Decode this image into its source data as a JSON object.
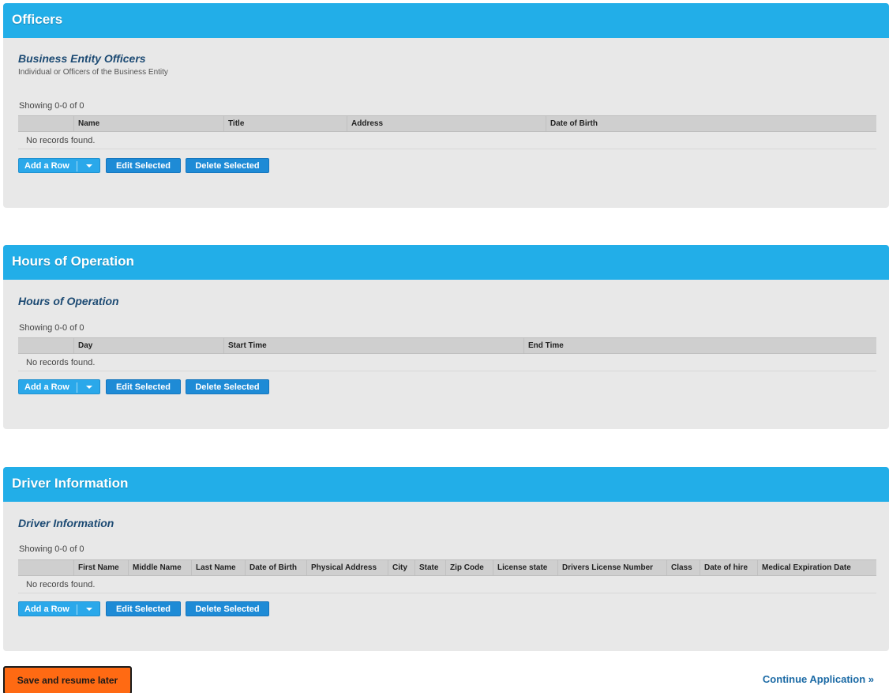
{
  "officers": {
    "header": "Officers",
    "subtitle": "Business Entity Officers",
    "description": "Individual or Officers of the Business Entity",
    "showing": "Showing 0-0 of 0",
    "columns": [
      "Name",
      "Title",
      "Address",
      "Date of Birth"
    ],
    "empty": "No records found.",
    "buttons": {
      "add": "Add a Row",
      "edit": "Edit Selected",
      "delete": "Delete Selected"
    }
  },
  "hours": {
    "header": "Hours of Operation",
    "subtitle": "Hours of Operation",
    "showing": "Showing 0-0 of 0",
    "columns": [
      "Day",
      "Start Time",
      "End Time"
    ],
    "empty": "No records found.",
    "buttons": {
      "add": "Add a Row",
      "edit": "Edit Selected",
      "delete": "Delete Selected"
    }
  },
  "drivers": {
    "header": "Driver Information",
    "subtitle": "Driver Information",
    "showing": "Showing 0-0 of 0",
    "columns": [
      "First Name",
      "Middle Name",
      "Last Name",
      "Date of Birth",
      "Physical Address",
      "City",
      "State",
      "Zip Code",
      "License state",
      "Drivers License Number",
      "Class",
      "Date of hire",
      "Medical Expiration Date"
    ],
    "empty": "No records found.",
    "buttons": {
      "add": "Add a Row",
      "edit": "Edit Selected",
      "delete": "Delete Selected"
    }
  },
  "footer": {
    "save": "Save and resume later",
    "continue": "Continue Application »"
  },
  "colors": {
    "header_blue": "#22aee8",
    "button_blue": "#1e8bd6",
    "save_orange": "#ff6a13",
    "link_blue": "#1b6aa5"
  }
}
